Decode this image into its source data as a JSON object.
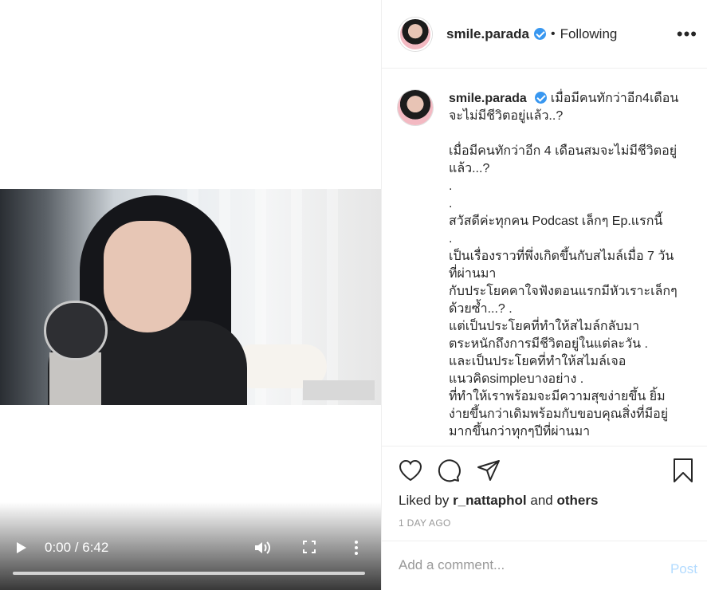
{
  "video": {
    "time_display": "0:00 / 6:42",
    "progress": 0
  },
  "header": {
    "username": "smile.parada",
    "separator": "•",
    "follow_status": "Following",
    "more": "•••"
  },
  "caption": {
    "username": "smile.parada",
    "lines": [
      "เมื่อมีคนทักว่าอีก4เดือน",
      "จะไม่มีชีวิตอยู่แล้ว..?",
      "",
      "เมื่อมีคนทักว่าอีก 4 เดือนสมจะไม่มีชีวิตอยู่",
      "แล้ว...?",
      ".",
      ".",
      "สวัสดีค่ะทุกคน Podcast เล็กๆ Ep.แรกนี้",
      ".",
      "เป็นเรื่องราวที่พึ่งเกิดขึ้นกับสไมล์เมื่อ 7 วัน",
      "ที่ผ่านมา",
      "กับประโยคคาใจฟังตอนแรกมีหัวเราะเล็กๆ",
      "ด้วยซ้ำ...? .",
      "แต่เป็นประโยคที่ทำให้สไมล์กลับมา",
      "ตระหนักถึงการมีชีวิตอยู่ในแต่ละวัน .",
      "และเป็นประโยคที่ทำให้สไมล์เจอ",
      "แนวคิดsimpleบางอย่าง .",
      "ที่ทำให้เราพร้อมจะมีความสุขง่ายขึ้น ยิ้ม",
      "ง่ายขึ้นกว่าเดิมพร้อมกับขอบคุณสิ่งที่มีอยู่",
      "มากขึ้นกว่าทุกๆปีที่ผ่านมา"
    ]
  },
  "actions": {
    "icons": [
      "heart-icon",
      "comment-icon",
      "share-icon",
      "bookmark-icon"
    ],
    "liked_prefix": "Liked by",
    "liked_user": "r_nattaphol",
    "liked_and": "and",
    "liked_others": "others",
    "timestamp": "1 DAY AGO"
  },
  "composer": {
    "placeholder": "Add a comment...",
    "post_label": "Post"
  }
}
